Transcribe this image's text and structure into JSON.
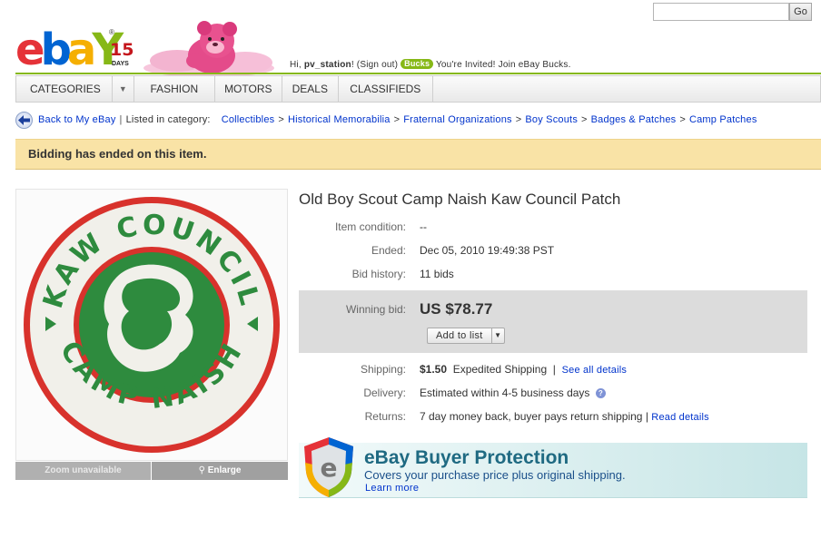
{
  "search": {
    "value": "",
    "go_label": "Go"
  },
  "header": {
    "logo_text": [
      "e",
      "b",
      "a",
      "Y"
    ],
    "logo_reg": "®",
    "anniversary_number": "15",
    "anniversary_word": "DAYS",
    "greeting_prefix": "Hi,",
    "username": "pv_station",
    "greeting_exclaim": "!",
    "sign_out": "(Sign out)",
    "bucks_badge": "Bucks",
    "invite_text": "You're Invited! Join eBay Bucks."
  },
  "nav": {
    "items": [
      {
        "label": "Categories"
      },
      {
        "label": "▼"
      },
      {
        "label": "Fashion"
      },
      {
        "label": "Motors"
      },
      {
        "label": "Deals"
      },
      {
        "label": "Classifieds"
      }
    ]
  },
  "breadcrumb": {
    "back_label": "Back to My eBay",
    "separator": "|",
    "listed_in": "Listed in category:",
    "path": [
      "Collectibles",
      "Historical Memorabilia",
      "Fraternal Organizations",
      "Boy Scouts",
      "Badges & Patches",
      "Camp Patches"
    ],
    "arrow": ">"
  },
  "banner": {
    "text": "Bidding has ended on this item."
  },
  "image_panel": {
    "zoom_label": "Zoom unavailable",
    "enlarge_label": "Enlarge",
    "patch_top_text": "KAW COUNCIL",
    "patch_bottom_text": "CAMP NAISH"
  },
  "item": {
    "title": "Old Boy Scout Camp Naish Kaw Council Patch",
    "condition_label": "Item condition:",
    "condition_value": "--",
    "ended_label": "Ended:",
    "ended_value": "Dec 05, 2010 19:49:38 PST",
    "bid_history_label": "Bid history:",
    "bid_history_value": "11 bids",
    "winning_bid_label": "Winning bid:",
    "winning_bid_value": "US $78.77",
    "add_to_list": "Add to list",
    "shipping_label": "Shipping:",
    "shipping_cost": "$1.50",
    "shipping_method": "Expedited Shipping",
    "shipping_sep": "|",
    "see_all_details": "See all details",
    "delivery_label": "Delivery:",
    "delivery_value": "Estimated within 4-5 business days",
    "help_glyph": "?",
    "returns_label": "Returns:",
    "returns_value": "7 day money back, buyer pays return shipping",
    "returns_sep": "|",
    "read_details": "Read details"
  },
  "buyer_protection": {
    "title": "eBay Buyer Protection",
    "subtitle": "Covers your purchase price plus original shipping.",
    "learn_more": "Learn more"
  },
  "colors": {
    "ebay_red": "#e53238",
    "ebay_blue": "#0064d2",
    "ebay_yellow": "#f5af02",
    "ebay_green": "#86b817",
    "banner_bg": "#f9e3a6",
    "patch_green": "#2e8b3e",
    "patch_red": "#d8322c"
  }
}
